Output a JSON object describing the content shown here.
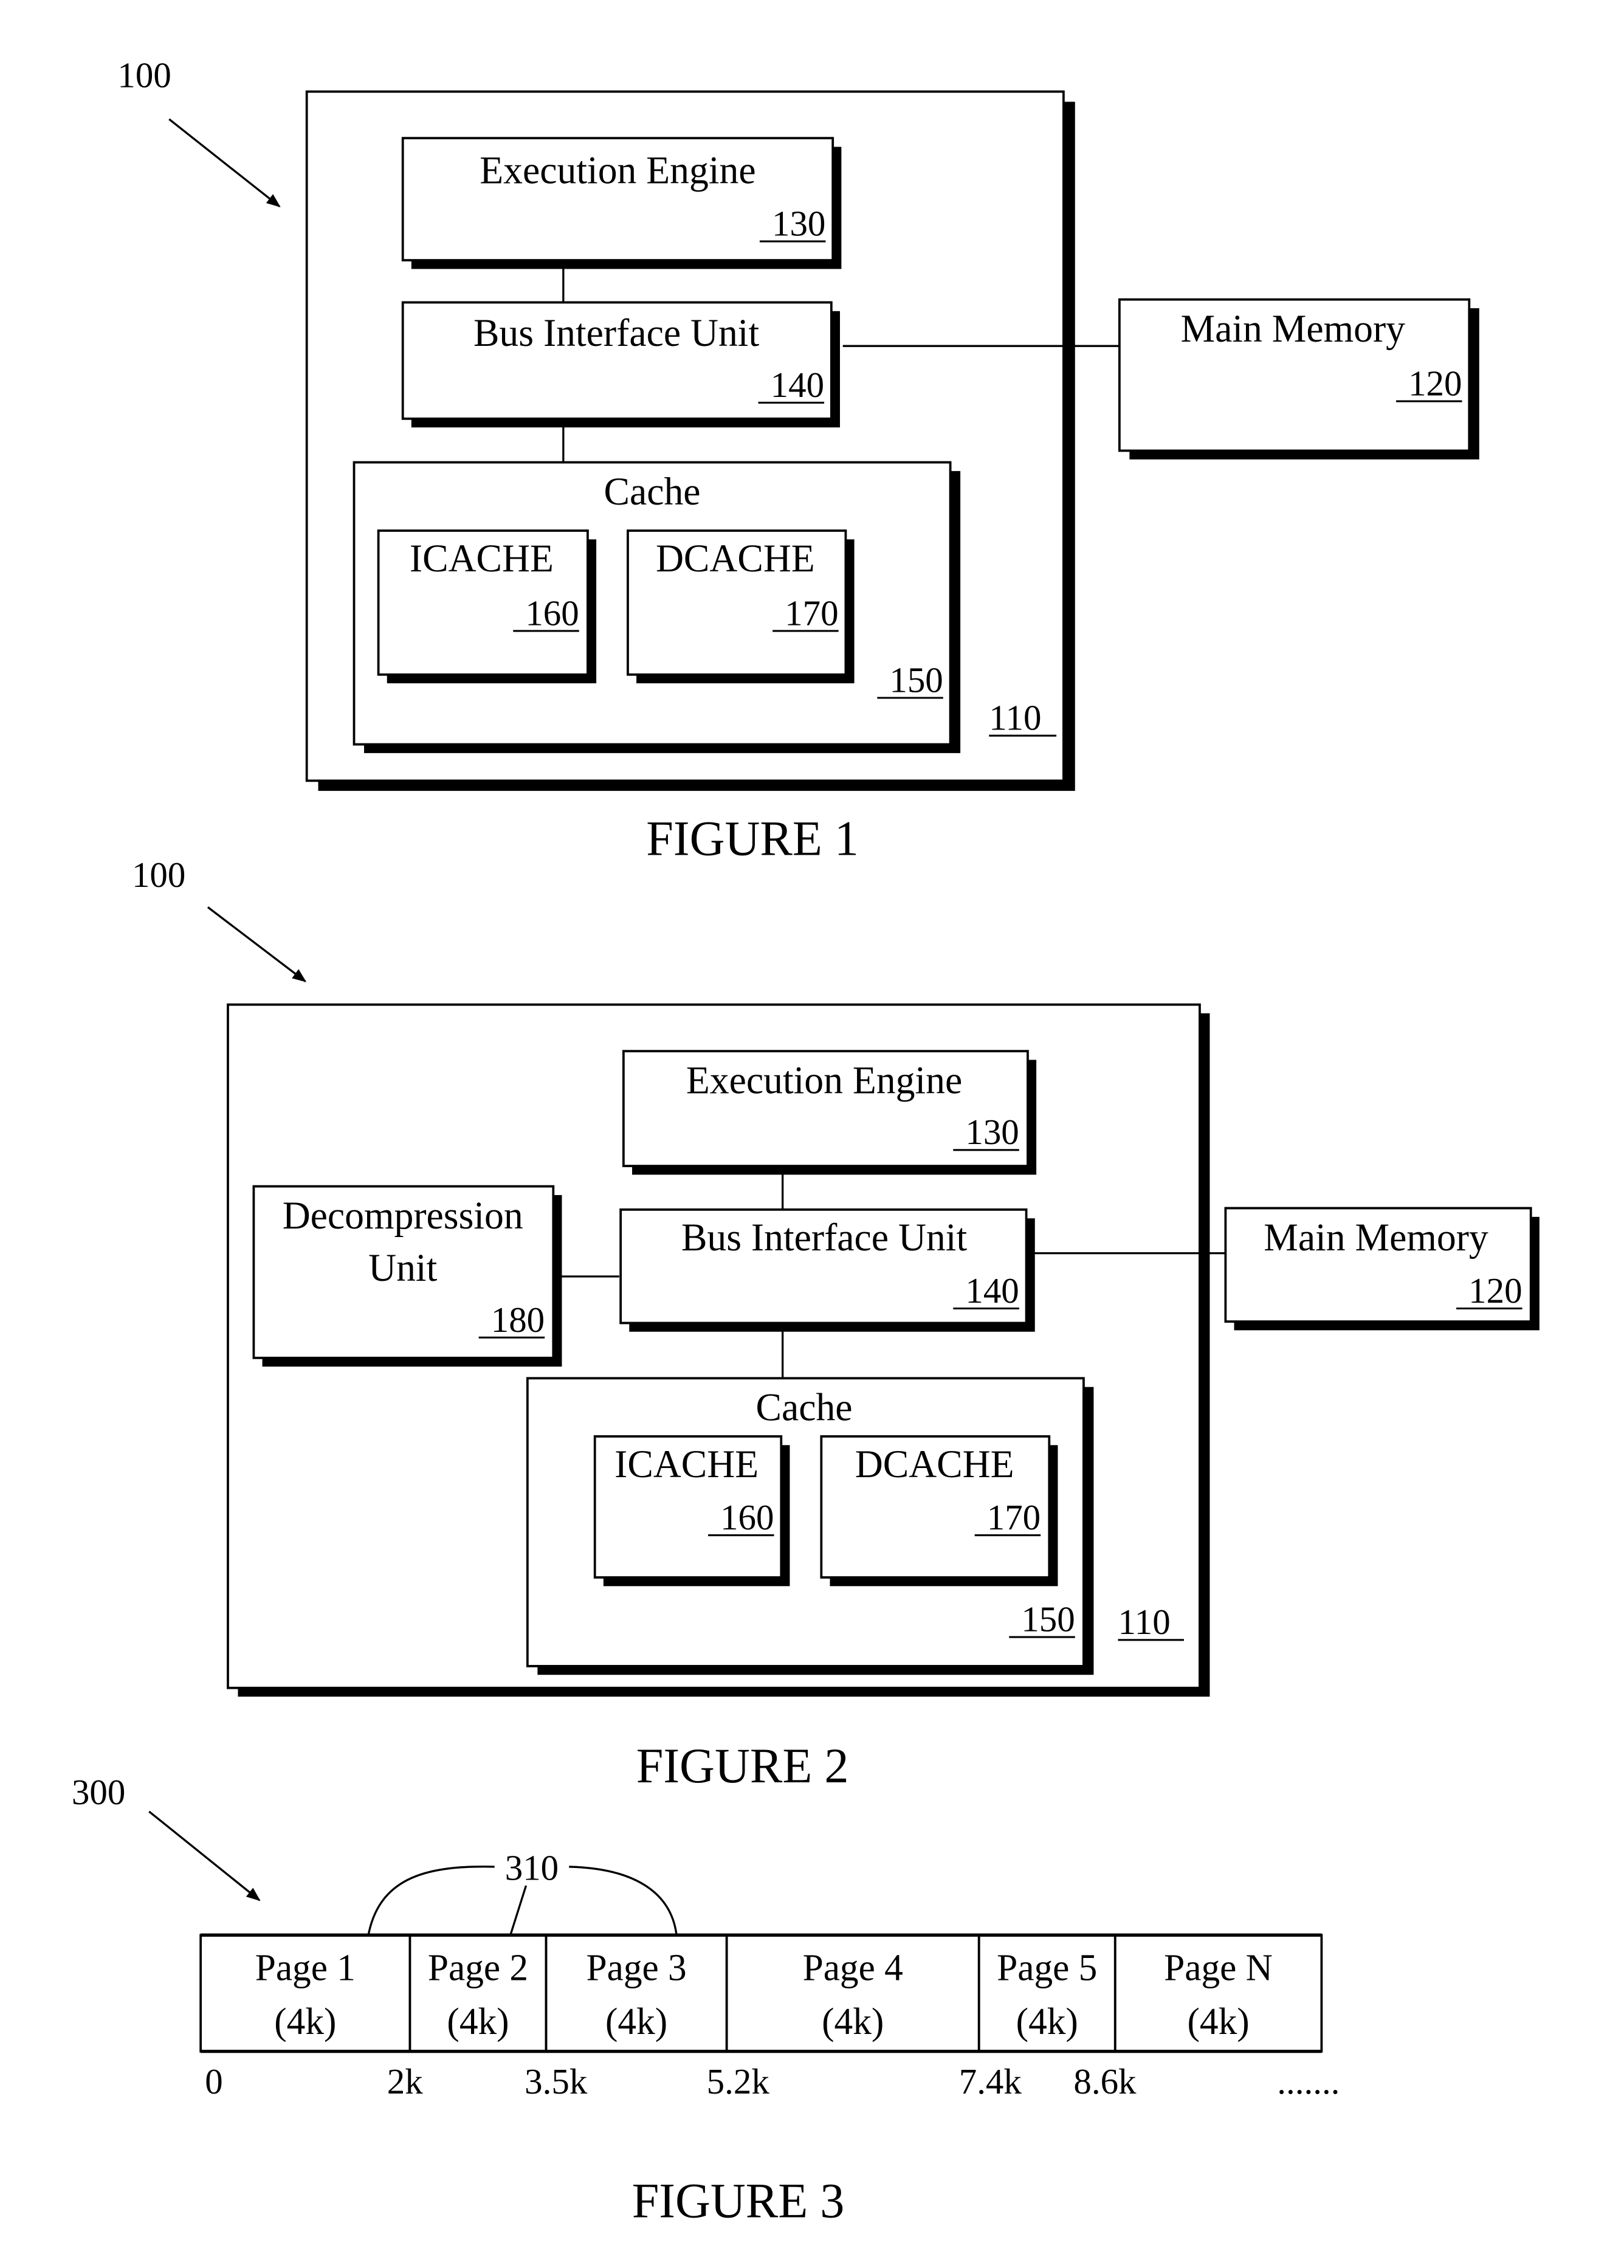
{
  "figure1": {
    "caption": "FIGURE 1",
    "system_ref": "100",
    "processor_ref": "110",
    "execution_engine": {
      "label": "Execution Engine",
      "ref": "130"
    },
    "bus_interface_unit": {
      "label": "Bus Interface Unit",
      "ref": "140"
    },
    "main_memory": {
      "label": "Main Memory",
      "ref": "120"
    },
    "cache": {
      "label": "Cache",
      "ref": "150"
    },
    "icache": {
      "label": "ICACHE",
      "ref": "160"
    },
    "dcache": {
      "label": "DCACHE",
      "ref": "170"
    }
  },
  "figure2": {
    "caption": "FIGURE 2",
    "system_ref": "100",
    "processor_ref": "110",
    "execution_engine": {
      "label": "Execution Engine",
      "ref": "130"
    },
    "bus_interface_unit": {
      "label": "Bus Interface Unit",
      "ref": "140"
    },
    "decompression_unit": {
      "label_line1": "Decompression",
      "label_line2": "Unit",
      "ref": "180"
    },
    "main_memory": {
      "label": "Main Memory",
      "ref": "120"
    },
    "cache": {
      "label": "Cache",
      "ref": "150"
    },
    "icache": {
      "label": "ICACHE",
      "ref": "160"
    },
    "dcache": {
      "label": "DCACHE",
      "ref": "170"
    }
  },
  "figure3": {
    "caption": "FIGURE 3",
    "memory_ref": "300",
    "group_ref": "310",
    "pages": [
      {
        "name": "Page 1",
        "size": "(4k)"
      },
      {
        "name": "Page 2",
        "size": "(4k)"
      },
      {
        "name": "Page 3",
        "size": "(4k)"
      },
      {
        "name": "Page 4",
        "size": "(4k)"
      },
      {
        "name": "Page 5",
        "size": "(4k)"
      },
      {
        "name": "Page N",
        "size": "(4k)"
      }
    ],
    "offsets": [
      "0",
      "2k",
      "3.5k",
      "5.2k",
      "7.4k",
      "8.6k",
      "......."
    ]
  }
}
